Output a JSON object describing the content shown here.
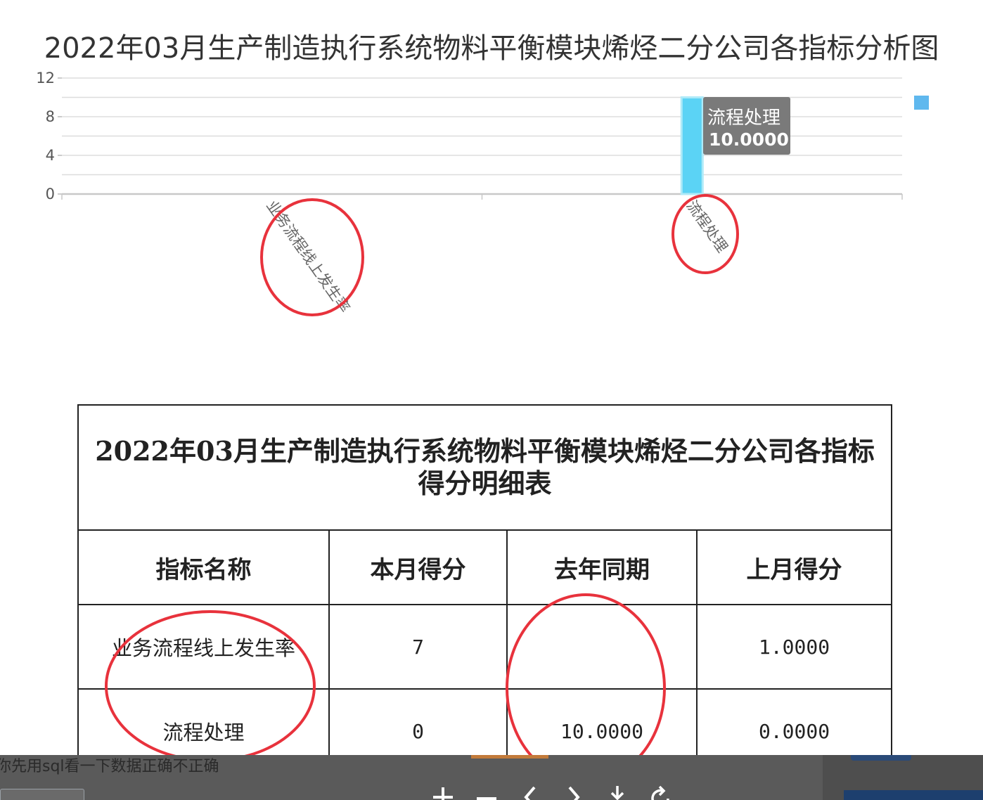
{
  "chart_data": {
    "type": "bar",
    "title": "2022年03月生产制造执行系统物料平衡模块烯烃二分公司各指标分析图",
    "categories": [
      "业务流程线上发生率",
      "流程处理"
    ],
    "series": [
      {
        "values": [
          0,
          10
        ]
      }
    ],
    "ylim": [
      0,
      12
    ],
    "yticks": [
      0,
      4,
      8,
      12
    ],
    "grid": true,
    "tooltip": {
      "label": "流程处理",
      "value": "10.0000"
    },
    "colors": {
      "bar": "#5bd3f5",
      "bar_edge": "#aeeaf8",
      "legend_marker": "#5fb8ee",
      "grid": "#dddddd",
      "tooltip_bg": "#7a7a7a",
      "annotation": "#e8323c"
    }
  },
  "table": {
    "title": "2022年03月生产制造执行系统物料平衡模块烯烃二分公司各指标得分明细表",
    "headers": [
      "指标名称",
      "本月得分",
      "去年同期",
      "上月得分"
    ],
    "rows": [
      [
        "业务流程线上发生率",
        "7",
        "",
        "1.0000"
      ],
      [
        "流程处理",
        "0",
        "10.0000",
        "0.0000"
      ]
    ]
  },
  "viewer": {
    "caption": "你先用sql看一下数据正确不正确",
    "tools": [
      "zoom-in-icon",
      "zoom-out-icon",
      "previous-icon",
      "next-icon",
      "download-icon",
      "rotate-icon"
    ]
  }
}
